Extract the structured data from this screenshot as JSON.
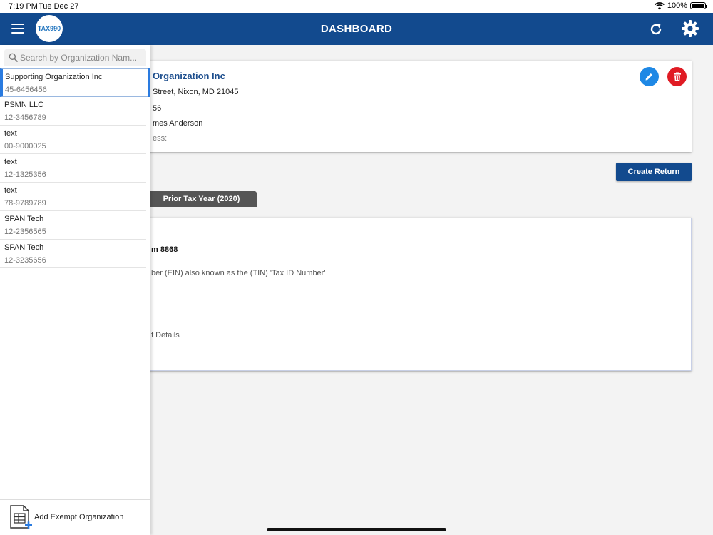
{
  "status_bar": {
    "time": "7:19 PM",
    "date": "Tue Dec 27",
    "battery": "100%"
  },
  "header": {
    "title": "DASHBOARD",
    "logo_text": "TAX990"
  },
  "organization_card": {
    "name": "Organization Inc",
    "address": "Street, Nixon, MD 21045",
    "ein_partial": "56",
    "contact_partial": "mes Anderson",
    "email_label_partial": "ess:"
  },
  "actions": {
    "create_return": "Create Return"
  },
  "tabs": {
    "prior_tax_year": "Prior Tax Year (2020)"
  },
  "info_card": {
    "form_heading_partial": "m 8868",
    "ein_note_partial": "ber (EIN) also known as the (TIN) 'Tax ID Number'",
    "details_partial": "f Details"
  },
  "sidebar": {
    "search_placeholder": "Search by Organization Nam...",
    "organizations": [
      {
        "name": "Supporting Organization Inc",
        "ein": "45-6456456"
      },
      {
        "name": "PSMN LLC",
        "ein": "12-3456789"
      },
      {
        "name": "text",
        "ein": "00-9000025"
      },
      {
        "name": "text",
        "ein": "12-1325356"
      },
      {
        "name": "text",
        "ein": "78-9789789"
      },
      {
        "name": "SPAN Tech",
        "ein": "12-2356565"
      },
      {
        "name": "SPAN Tech",
        "ein": "12-3235656"
      }
    ],
    "add_label": "Add Exempt Organization"
  },
  "colors": {
    "brand": "#124a8e",
    "accent": "#2a7be0",
    "delete": "#e01b24",
    "edit": "#1e88e5"
  }
}
